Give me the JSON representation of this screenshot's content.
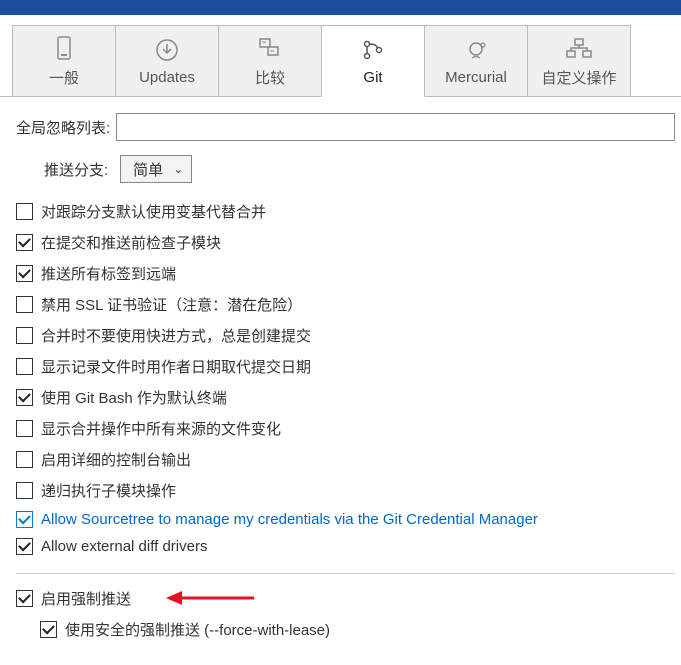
{
  "tabs": [
    {
      "label": "一般",
      "icon": "device-icon"
    },
    {
      "label": "Updates",
      "icon": "download-icon"
    },
    {
      "label": "比较",
      "icon": "compare-icon"
    },
    {
      "label": "Git",
      "icon": "git-icon"
    },
    {
      "label": "Mercurial",
      "icon": "mercurial-icon"
    },
    {
      "label": "自定义操作",
      "icon": "customize-icon"
    }
  ],
  "ignore": {
    "label": "全局忽略列表:",
    "value": ""
  },
  "push": {
    "label": "推送分支:",
    "selected": "简单"
  },
  "checks": [
    {
      "label": "对跟踪分支默认使用变基代替合并",
      "checked": false
    },
    {
      "label": "在提交和推送前检查子模块",
      "checked": true
    },
    {
      "label": "推送所有标签到远端",
      "checked": true
    },
    {
      "label": "禁用 SSL 证书验证（注意：潜在危险）",
      "checked": false
    },
    {
      "label": "合并时不要使用快进方式，总是创建提交",
      "checked": false
    },
    {
      "label": "显示记录文件时用作者日期取代提交日期",
      "checked": false
    },
    {
      "label": "使用 Git Bash 作为默认终端",
      "checked": true
    },
    {
      "label": "显示合并操作中所有来源的文件变化",
      "checked": false
    },
    {
      "label": "启用详细的控制台输出",
      "checked": false
    },
    {
      "label": "递归执行子模块操作",
      "checked": false
    },
    {
      "label": "Allow Sourcetree to manage my credentials via the Git Credential Manager",
      "checked": true,
      "blue": true
    },
    {
      "label": "Allow external diff drivers",
      "checked": true
    }
  ],
  "force": {
    "enable": {
      "label": "启用强制推送",
      "checked": true
    },
    "safe": {
      "label": "使用安全的强制推送 (--force-with-lease)",
      "checked": true
    }
  }
}
